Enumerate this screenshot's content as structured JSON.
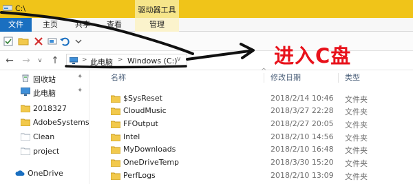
{
  "window": {
    "title": "C:\\"
  },
  "ribbon": {
    "context_tab_group": "驱动器工具",
    "tabs": {
      "file": "文件",
      "home": "主页",
      "share": "共享",
      "view": "查看",
      "manage": "管理"
    }
  },
  "address": {
    "this_pc": "此电脑",
    "drive": "Windows (C:)",
    "separator": ">",
    "dropdown": "v"
  },
  "nav": {
    "back": "←",
    "forward": "→",
    "recent": "v",
    "up": "↑"
  },
  "annotation": {
    "text": "进入C盘"
  },
  "navpane": {
    "items": [
      {
        "label": "回收站",
        "icon": "recycle-bin-icon",
        "pinned": true
      },
      {
        "label": "此电脑",
        "icon": "computer-icon",
        "pinned": true
      },
      {
        "label": "2018327",
        "icon": "folder-icon",
        "pinned": false
      },
      {
        "label": "AdobeSystems",
        "icon": "folder-icon",
        "pinned": false
      },
      {
        "label": "Clean",
        "icon": "folder-icon",
        "pinned": false
      },
      {
        "label": "project",
        "icon": "folder-icon",
        "pinned": false
      },
      {
        "label": "OneDrive",
        "icon": "onedrive-icon",
        "pinned": false
      }
    ],
    "pin_glyph": "✦"
  },
  "columns": {
    "name": "名称",
    "modified": "修改日期",
    "type": "类型",
    "sort_caret": "^"
  },
  "files": [
    {
      "name": "$SysReset",
      "modified": "2018/2/14 10:46",
      "type": "文件夹"
    },
    {
      "name": "CloudMusic",
      "modified": "2018/3/27 22:28",
      "type": "文件夹"
    },
    {
      "name": "FFOutput",
      "modified": "2018/2/27 20:05",
      "type": "文件夹"
    },
    {
      "name": "Intel",
      "modified": "2018/2/10 14:56",
      "type": "文件夹"
    },
    {
      "name": "MyDownloads",
      "modified": "2018/2/10 16:48",
      "type": "文件夹"
    },
    {
      "name": "OneDriveTemp",
      "modified": "2018/3/30 15:20",
      "type": "文件夹"
    },
    {
      "name": "PerfLogs",
      "modified": "2018/2/10 13:09",
      "type": "文件夹"
    }
  ],
  "colors": {
    "titlebar": "#f0c419",
    "file_tab": "#1a6fc0",
    "annotation": "#e8121b",
    "folder": "#f2c94c"
  }
}
